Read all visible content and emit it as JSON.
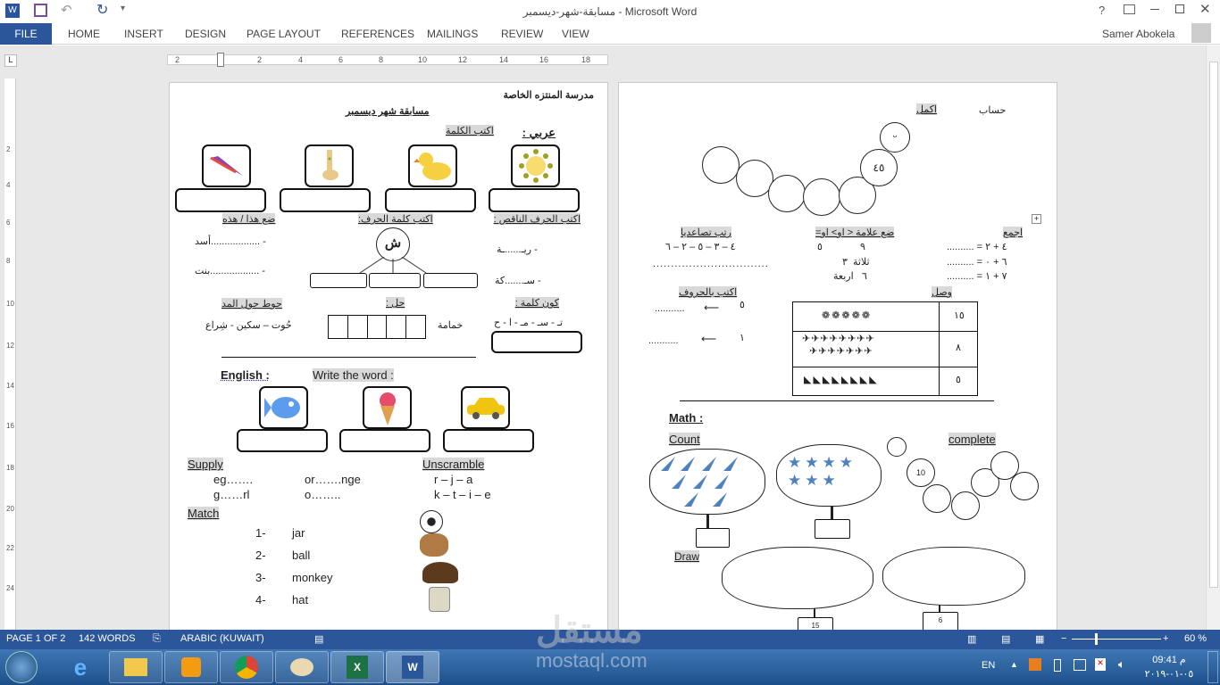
{
  "window": {
    "title": "مسابقة-شهر-ديسمبر - Microsoft Word",
    "help": "?",
    "user": "Samer Abokela"
  },
  "ribbon": {
    "tabs": [
      "FILE",
      "HOME",
      "INSERT",
      "DESIGN",
      "PAGE LAYOUT",
      "REFERENCES",
      "MAILINGS",
      "REVIEW",
      "VIEW"
    ]
  },
  "ruler": {
    "ticks": [
      "2",
      "2",
      "4",
      "6",
      "8",
      "10",
      "12",
      "14",
      "16",
      "18"
    ],
    "vticks": [
      "2",
      "4",
      "6",
      "8",
      "10",
      "12",
      "14",
      "16",
      "18",
      "20",
      "22",
      "24"
    ]
  },
  "page1": {
    "school": "مدرسة المنتزه الخاصة",
    "title": "مسابقة شهر ديسمبر",
    "arabic_label": "عربي :",
    "write_word": "اكتب الكلمة",
    "missing_letter": "اكتب الحرف الناقص :",
    "letter_word": "اكتب كلمة الحرف:",
    "this_that": "ضع هذا / هذه",
    "missing1": "- ريـ......ـة",
    "missing2": "- سـ.......كة",
    "letter": "ش",
    "this1": "- ..................أسد",
    "this2": "- ..................بنت",
    "form_word": "كون كلمة :",
    "form_letters": "تـ - سـ - مـ - ا - ح",
    "solve": "حل :",
    "solve_word": "خمامة",
    "circle_madd": "حوط حول المد",
    "madd_words": "حُوت – سكين - شِراع",
    "english": "English :",
    "write_the_word": "Write the word :",
    "supply": "Supply",
    "supply_items": [
      "eg…….",
      "or…….nge",
      "g……rl",
      "o…….."
    ],
    "unscramble": "Unscramble",
    "unscramble_items": [
      "r – j – a",
      "k – t – i – e"
    ],
    "match": "Match",
    "match_items": [
      {
        "n": "1-",
        "w": "jar"
      },
      {
        "n": "2-",
        "w": "ball"
      },
      {
        "n": "3-",
        "w": "monkey"
      },
      {
        "n": "4-",
        "w": "hat"
      }
    ]
  },
  "page2": {
    "hisab": "حساب",
    "complete_ar": "اكمل",
    "caterpillar_num": "٤٥",
    "add": "اجمع",
    "add_items": [
      "٤ + ٢ = ..........",
      "٦ + ٠ = ..........",
      "٧ + ١ = .........."
    ],
    "compare": "ضع علامة < او> او=",
    "compare_rows": [
      [
        "٩",
        "٥"
      ],
      [
        "ثلاثة",
        "٣"
      ],
      [
        "٦",
        "اربعة"
      ]
    ],
    "order": "رتب تصاعديا",
    "order_nums": "٤ – ٣ – ٥ – ٢ – ٦",
    "order_line": "................................",
    "connect": "وصل",
    "connect_nums": [
      "١٥",
      "٨",
      "٥"
    ],
    "write_letters": "اكتب بالحروف",
    "write_nums": [
      "٥",
      "١"
    ],
    "dots": "...........",
    "math": "Math :",
    "count": "Count",
    "complete": "complete",
    "cat_num": "10",
    "draw": "Draw",
    "draw_nums": [
      "15",
      "6"
    ]
  },
  "status": {
    "page": "PAGE 1 OF 2",
    "words": "142 WORDS",
    "language": "ARABIC (KUWAIT)",
    "zoom": "60 %",
    "zoom_level": 60
  },
  "taskbar": {
    "lang": "EN",
    "time": "09:41 م",
    "date": "٠٥-٠١-٢٠١٩",
    "watermark": "mostaql.com"
  },
  "colors": {
    "accent": "#2b579a",
    "shape_blue": "#4f81bd"
  }
}
